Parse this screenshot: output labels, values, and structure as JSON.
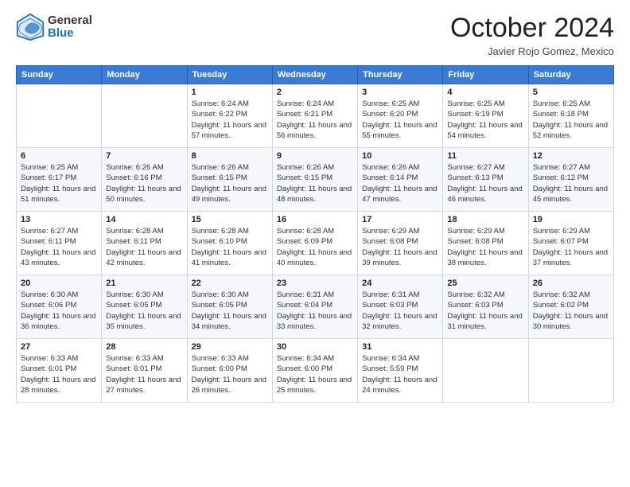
{
  "logo": {
    "general": "General",
    "blue": "Blue"
  },
  "header": {
    "month": "October 2024",
    "location": "Javier Rojo Gomez, Mexico"
  },
  "days_of_week": [
    "Sunday",
    "Monday",
    "Tuesday",
    "Wednesday",
    "Thursday",
    "Friday",
    "Saturday"
  ],
  "weeks": [
    [
      {
        "day": "",
        "info": ""
      },
      {
        "day": "",
        "info": ""
      },
      {
        "day": "1",
        "info": "Sunrise: 6:24 AM\nSunset: 6:22 PM\nDaylight: 11 hours and 57 minutes."
      },
      {
        "day": "2",
        "info": "Sunrise: 6:24 AM\nSunset: 6:21 PM\nDaylight: 11 hours and 56 minutes."
      },
      {
        "day": "3",
        "info": "Sunrise: 6:25 AM\nSunset: 6:20 PM\nDaylight: 11 hours and 55 minutes."
      },
      {
        "day": "4",
        "info": "Sunrise: 6:25 AM\nSunset: 6:19 PM\nDaylight: 11 hours and 54 minutes."
      },
      {
        "day": "5",
        "info": "Sunrise: 6:25 AM\nSunset: 6:18 PM\nDaylight: 11 hours and 52 minutes."
      }
    ],
    [
      {
        "day": "6",
        "info": "Sunrise: 6:25 AM\nSunset: 6:17 PM\nDaylight: 11 hours and 51 minutes."
      },
      {
        "day": "7",
        "info": "Sunrise: 6:26 AM\nSunset: 6:16 PM\nDaylight: 11 hours and 50 minutes."
      },
      {
        "day": "8",
        "info": "Sunrise: 6:26 AM\nSunset: 6:15 PM\nDaylight: 11 hours and 49 minutes."
      },
      {
        "day": "9",
        "info": "Sunrise: 6:26 AM\nSunset: 6:15 PM\nDaylight: 11 hours and 48 minutes."
      },
      {
        "day": "10",
        "info": "Sunrise: 6:26 AM\nSunset: 6:14 PM\nDaylight: 11 hours and 47 minutes."
      },
      {
        "day": "11",
        "info": "Sunrise: 6:27 AM\nSunset: 6:13 PM\nDaylight: 11 hours and 46 minutes."
      },
      {
        "day": "12",
        "info": "Sunrise: 6:27 AM\nSunset: 6:12 PM\nDaylight: 11 hours and 45 minutes."
      }
    ],
    [
      {
        "day": "13",
        "info": "Sunrise: 6:27 AM\nSunset: 6:11 PM\nDaylight: 11 hours and 43 minutes."
      },
      {
        "day": "14",
        "info": "Sunrise: 6:28 AM\nSunset: 6:11 PM\nDaylight: 11 hours and 42 minutes."
      },
      {
        "day": "15",
        "info": "Sunrise: 6:28 AM\nSunset: 6:10 PM\nDaylight: 11 hours and 41 minutes."
      },
      {
        "day": "16",
        "info": "Sunrise: 6:28 AM\nSunset: 6:09 PM\nDaylight: 11 hours and 40 minutes."
      },
      {
        "day": "17",
        "info": "Sunrise: 6:29 AM\nSunset: 6:08 PM\nDaylight: 11 hours and 39 minutes."
      },
      {
        "day": "18",
        "info": "Sunrise: 6:29 AM\nSunset: 6:08 PM\nDaylight: 11 hours and 38 minutes."
      },
      {
        "day": "19",
        "info": "Sunrise: 6:29 AM\nSunset: 6:07 PM\nDaylight: 11 hours and 37 minutes."
      }
    ],
    [
      {
        "day": "20",
        "info": "Sunrise: 6:30 AM\nSunset: 6:06 PM\nDaylight: 11 hours and 36 minutes."
      },
      {
        "day": "21",
        "info": "Sunrise: 6:30 AM\nSunset: 6:05 PM\nDaylight: 11 hours and 35 minutes."
      },
      {
        "day": "22",
        "info": "Sunrise: 6:30 AM\nSunset: 6:05 PM\nDaylight: 11 hours and 34 minutes."
      },
      {
        "day": "23",
        "info": "Sunrise: 6:31 AM\nSunset: 6:04 PM\nDaylight: 11 hours and 33 minutes."
      },
      {
        "day": "24",
        "info": "Sunrise: 6:31 AM\nSunset: 6:03 PM\nDaylight: 11 hours and 32 minutes."
      },
      {
        "day": "25",
        "info": "Sunrise: 6:32 AM\nSunset: 6:03 PM\nDaylight: 11 hours and 31 minutes."
      },
      {
        "day": "26",
        "info": "Sunrise: 6:32 AM\nSunset: 6:02 PM\nDaylight: 11 hours and 30 minutes."
      }
    ],
    [
      {
        "day": "27",
        "info": "Sunrise: 6:33 AM\nSunset: 6:01 PM\nDaylight: 11 hours and 28 minutes."
      },
      {
        "day": "28",
        "info": "Sunrise: 6:33 AM\nSunset: 6:01 PM\nDaylight: 11 hours and 27 minutes."
      },
      {
        "day": "29",
        "info": "Sunrise: 6:33 AM\nSunset: 6:00 PM\nDaylight: 11 hours and 26 minutes."
      },
      {
        "day": "30",
        "info": "Sunrise: 6:34 AM\nSunset: 6:00 PM\nDaylight: 11 hours and 25 minutes."
      },
      {
        "day": "31",
        "info": "Sunrise: 6:34 AM\nSunset: 5:59 PM\nDaylight: 11 hours and 24 minutes."
      },
      {
        "day": "",
        "info": ""
      },
      {
        "day": "",
        "info": ""
      }
    ]
  ]
}
